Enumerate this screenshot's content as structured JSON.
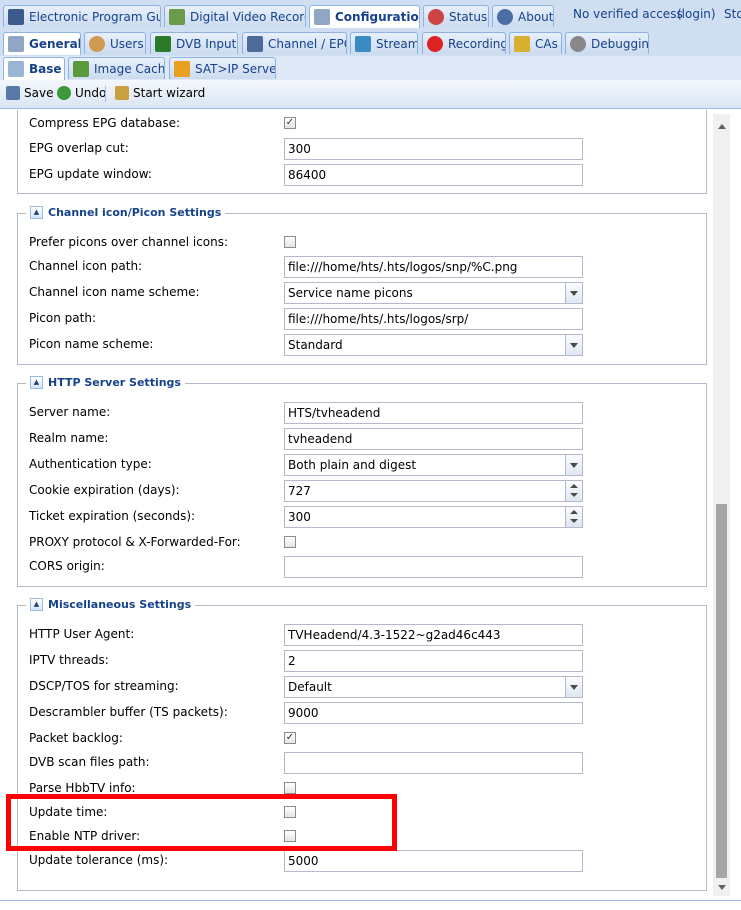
{
  "top_tabs": [
    {
      "label": "Electronic Program Guide",
      "icon": "epg-icon",
      "active": false
    },
    {
      "label": "Digital Video Recorder",
      "icon": "dvr-download-icon",
      "active": false
    },
    {
      "label": "Configuration",
      "icon": "wrench-icon",
      "active": true
    },
    {
      "label": "Status",
      "icon": "eye-icon",
      "active": false
    },
    {
      "label": "About",
      "icon": "info-icon",
      "active": false
    }
  ],
  "access_text": "No verified access",
  "login_link": "(login)",
  "storage_text": "Sto",
  "config_tabs": [
    {
      "label": "General",
      "icon": "wrench-icon",
      "active": true
    },
    {
      "label": "Users",
      "icon": "users-icon",
      "active": false
    },
    {
      "label": "DVB Inputs",
      "icon": "dvb-card-icon",
      "active": false
    },
    {
      "label": "Channel / EPG",
      "icon": "tv-icon",
      "active": false
    },
    {
      "label": "Stream",
      "icon": "stream-icon",
      "active": false
    },
    {
      "label": "Recording",
      "icon": "rec-icon",
      "active": false
    },
    {
      "label": "CAs",
      "icon": "key-icon",
      "active": false
    },
    {
      "label": "Debugging",
      "icon": "bug-icon",
      "active": false
    }
  ],
  "sub_tabs": [
    {
      "label": "Base",
      "icon": "house-icon",
      "active": true
    },
    {
      "label": "Image Cache",
      "icon": "image-cache-icon",
      "active": false
    },
    {
      "label": "SAT>IP Server",
      "icon": "satip-icon",
      "active": false
    }
  ],
  "toolbar": {
    "save": "Save",
    "undo": "Undo",
    "wizard": "Start wizard"
  },
  "sections": {
    "epg": {
      "compress_label": "Compress EPG database:",
      "compress_checked": "✓",
      "overlap_label": "EPG overlap cut:",
      "overlap_value": "300",
      "window_label": "EPG update window:",
      "window_value": "86400"
    },
    "picon": {
      "title": "Channel icon/Picon Settings",
      "prefer_label": "Prefer picons over channel icons:",
      "prefer_checked": "",
      "path_label": "Channel icon path:",
      "path_value": "file:///home/hts/.hts/logos/snp/%C.png",
      "scheme_label": "Channel icon name scheme:",
      "scheme_value": "Service name picons",
      "picon_path_label": "Picon path:",
      "picon_path_value": "file:///home/hts/.hts/logos/srp/",
      "picon_scheme_label": "Picon name scheme:",
      "picon_scheme_value": "Standard"
    },
    "http": {
      "title": "HTTP Server Settings",
      "server_label": "Server name:",
      "server_value": "HTS/tvheadend",
      "realm_label": "Realm name:",
      "realm_value": "tvheadend",
      "auth_label": "Authentication type:",
      "auth_value": "Both plain and digest",
      "cookie_label": "Cookie expiration (days):",
      "cookie_value": "727",
      "ticket_label": "Ticket expiration (seconds):",
      "ticket_value": "300",
      "proxy_label": "PROXY protocol & X-Forwarded-For:",
      "proxy_checked": "",
      "cors_label": "CORS origin:",
      "cors_value": ""
    },
    "misc": {
      "title": "Miscellaneous Settings",
      "agent_label": "HTTP User Agent:",
      "agent_value": "TVHeadend/4.3-1522~g2ad46c443",
      "iptv_label": "IPTV threads:",
      "iptv_value": "2",
      "dscp_label": "DSCP/TOS for streaming:",
      "dscp_value": "Default",
      "descr_label": "Descrambler buffer (TS packets):",
      "descr_value": "9000",
      "backlog_label": "Packet backlog:",
      "backlog_checked": "✓",
      "dvbscan_label": "DVB scan files path:",
      "dvbscan_value": "",
      "hbbtv_label": "Parse HbbTV info:",
      "hbbtv_checked": "",
      "update_time_label": "Update time:",
      "update_time_checked": "",
      "ntp_label": "Enable NTP driver:",
      "ntp_checked": "",
      "tolerance_label": "Update tolerance (ms):",
      "tolerance_value": "5000"
    }
  },
  "colors": {
    "highlight": "#ff0000",
    "tab_text": "#15428b",
    "panel_border": "#99bbe8"
  }
}
